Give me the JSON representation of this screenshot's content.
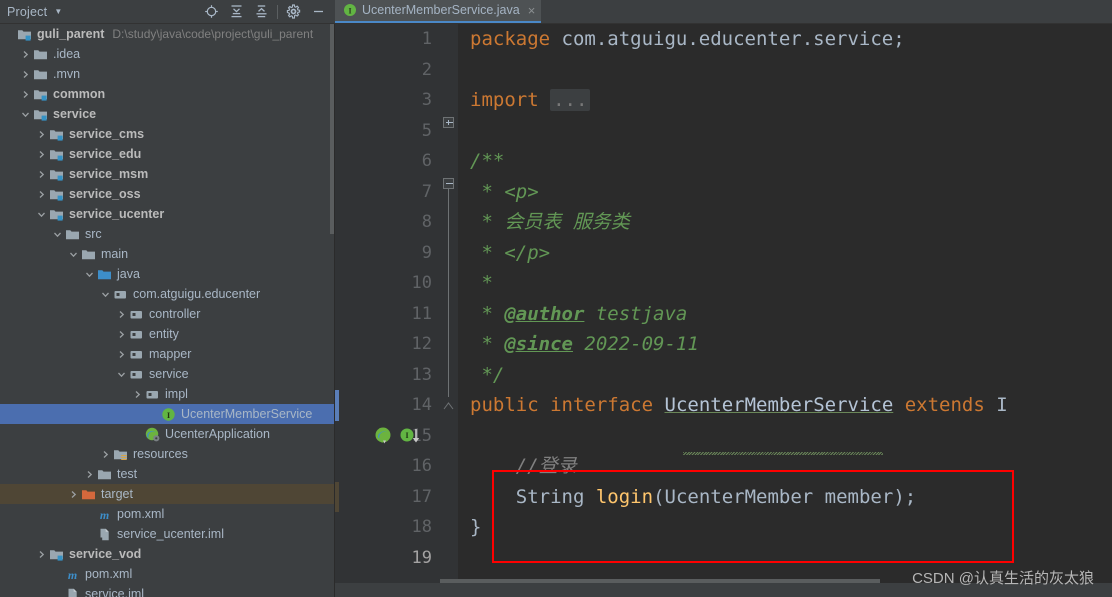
{
  "window": {
    "tool_title": "Project",
    "toolbar_icons": [
      "locate-icon",
      "expand-all-icon",
      "collapse-all-icon",
      "settings-gear-icon",
      "minimize-icon"
    ]
  },
  "editor_tab": {
    "filename": "UcenterMemberService.java",
    "icon": "interface-icon",
    "close": "×"
  },
  "project_tree": [
    {
      "label": "guli_parent",
      "path": "D:\\study\\java\\code\\project\\guli_parent",
      "indent": 0,
      "arrow": "none",
      "icon": "module-folder",
      "bold": true
    },
    {
      "label": ".idea",
      "path": "",
      "indent": 1,
      "arrow": "collapsed",
      "icon": "folder",
      "bold": false
    },
    {
      "label": ".mvn",
      "path": "",
      "indent": 1,
      "arrow": "collapsed",
      "icon": "folder",
      "bold": false
    },
    {
      "label": "common",
      "path": "",
      "indent": 1,
      "arrow": "collapsed",
      "icon": "module-folder",
      "bold": true
    },
    {
      "label": "service",
      "path": "",
      "indent": 1,
      "arrow": "expanded",
      "icon": "module-folder",
      "bold": true
    },
    {
      "label": "service_cms",
      "path": "",
      "indent": 2,
      "arrow": "collapsed",
      "icon": "module-folder",
      "bold": true
    },
    {
      "label": "service_edu",
      "path": "",
      "indent": 2,
      "arrow": "collapsed",
      "icon": "module-folder",
      "bold": true
    },
    {
      "label": "service_msm",
      "path": "",
      "indent": 2,
      "arrow": "collapsed",
      "icon": "module-folder",
      "bold": true
    },
    {
      "label": "service_oss",
      "path": "",
      "indent": 2,
      "arrow": "collapsed",
      "icon": "module-folder",
      "bold": true
    },
    {
      "label": "service_ucenter",
      "path": "",
      "indent": 2,
      "arrow": "expanded",
      "icon": "module-folder",
      "bold": true
    },
    {
      "label": "src",
      "path": "",
      "indent": 3,
      "arrow": "expanded",
      "icon": "folder",
      "bold": false
    },
    {
      "label": "main",
      "path": "",
      "indent": 4,
      "arrow": "expanded",
      "icon": "folder",
      "bold": false
    },
    {
      "label": "java",
      "path": "",
      "indent": 5,
      "arrow": "expanded",
      "icon": "source-folder",
      "bold": false
    },
    {
      "label": "com.atguigu.educenter",
      "path": "",
      "indent": 6,
      "arrow": "expanded",
      "icon": "package",
      "bold": false
    },
    {
      "label": "controller",
      "path": "",
      "indent": 7,
      "arrow": "collapsed",
      "icon": "package",
      "bold": false
    },
    {
      "label": "entity",
      "path": "",
      "indent": 7,
      "arrow": "collapsed",
      "icon": "package",
      "bold": false
    },
    {
      "label": "mapper",
      "path": "",
      "indent": 7,
      "arrow": "collapsed",
      "icon": "package",
      "bold": false
    },
    {
      "label": "service",
      "path": "",
      "indent": 7,
      "arrow": "expanded",
      "icon": "package",
      "bold": false
    },
    {
      "label": "impl",
      "path": "",
      "indent": 8,
      "arrow": "collapsed",
      "icon": "package",
      "bold": false
    },
    {
      "label": "UcenterMemberService",
      "path": "",
      "indent": 9,
      "arrow": "none",
      "icon": "interface-icon",
      "bold": false,
      "selected": true
    },
    {
      "label": "UcenterApplication",
      "path": "",
      "indent": 8,
      "arrow": "none",
      "icon": "spring-class-icon",
      "bold": false
    },
    {
      "label": "resources",
      "path": "",
      "indent": 6,
      "arrow": "collapsed",
      "icon": "resources-folder",
      "bold": false
    },
    {
      "label": "test",
      "path": "",
      "indent": 5,
      "arrow": "collapsed",
      "icon": "folder",
      "bold": false
    },
    {
      "label": "target",
      "path": "",
      "indent": 4,
      "arrow": "collapsed",
      "icon": "target-folder",
      "bold": false,
      "marked": true
    },
    {
      "label": "pom.xml",
      "path": "",
      "indent": 5,
      "arrow": "none",
      "icon": "maven-icon",
      "bold": false
    },
    {
      "label": "service_ucenter.iml",
      "path": "",
      "indent": 5,
      "arrow": "none",
      "icon": "iml-icon",
      "bold": false
    },
    {
      "label": "service_vod",
      "path": "",
      "indent": 2,
      "arrow": "collapsed",
      "icon": "module-folder",
      "bold": true
    },
    {
      "label": "pom.xml",
      "path": "",
      "indent": 3,
      "arrow": "none",
      "icon": "maven-icon",
      "bold": false
    },
    {
      "label": "service.iml",
      "path": "",
      "indent": 3,
      "arrow": "none",
      "icon": "iml-icon",
      "bold": false
    }
  ],
  "code": {
    "line_numbers": [
      "1",
      "2",
      "3",
      "5",
      "6",
      "7",
      "8",
      "9",
      "10",
      "11",
      "12",
      "13",
      "14",
      "15",
      "16",
      "17",
      "18",
      "19"
    ],
    "current_line": "19",
    "lines": [
      {
        "n": "1",
        "text": "package com.atguigu.educenter.service;"
      },
      {
        "n": "2",
        "text": ""
      },
      {
        "n": "3",
        "text": "import ..."
      },
      {
        "n": "5",
        "text": ""
      },
      {
        "n": "6",
        "text": "/**"
      },
      {
        "n": "7",
        "text": " * <p>"
      },
      {
        "n": "8",
        "text": " * 会员表 服务类"
      },
      {
        "n": "9",
        "text": " * </p>"
      },
      {
        "n": "10",
        "text": " *"
      },
      {
        "n": "11",
        "text": " * @author testjava"
      },
      {
        "n": "12",
        "text": " * @since 2022-09-11"
      },
      {
        "n": "13",
        "text": " */"
      },
      {
        "n": "14",
        "text": "public interface UcenterMemberService extends I"
      },
      {
        "n": "15",
        "text": ""
      },
      {
        "n": "16",
        "text": "    //登录"
      },
      {
        "n": "17",
        "text": "    String login(UcenterMember member);"
      },
      {
        "n": "18",
        "text": "}"
      },
      {
        "n": "19",
        "text": ""
      }
    ],
    "tokens": {
      "kw_package": "package",
      "pkg_name": " com.atguigu.educenter.service;",
      "kw_import": "import",
      "import_ellipsis": "...",
      "javadoc_open": "/**",
      "javadoc_p_open": " * <p>",
      "javadoc_star": " * ",
      "javadoc_cn": "会员表 服务类",
      "javadoc_p_close": " * </p>",
      "javadoc_blank": " *",
      "tag_author": "@author",
      "author_value": " testjava",
      "tag_since": "@since",
      "since_value": " 2022-09-11",
      "javadoc_close": " */",
      "kw_public": "public",
      "kw_interface": "interface",
      "type_name": "UcenterMemberService",
      "kw_extends": "extends",
      "extends_partial": "I",
      "line_comment": "//登录",
      "ret_type": "String",
      "method_name": "login",
      "paren_open": "(",
      "param_type": "UcenterMember",
      "param_name": " member",
      "paren_close": ");",
      "close_brace": "}"
    },
    "gutter_icons": {
      "line": "14",
      "icons": [
        "spring-bean-icon",
        "implemented-by-icon"
      ]
    }
  },
  "watermark": "CSDN @认真生活的灰太狼",
  "colors": {
    "panel_bg": "#3c3f41",
    "editor_bg": "#2b2b2b",
    "gutter_bg": "#313335",
    "selection_blue": "#4b6eaf",
    "marked_brown": "#4f4635",
    "keyword_orange": "#cc7832",
    "comment_green": "#629755",
    "text_gray": "#a9b7c6",
    "method_yellow": "#ffc66d",
    "highlight_red": "#ff0000",
    "tab_underline": "#4a88c7"
  }
}
